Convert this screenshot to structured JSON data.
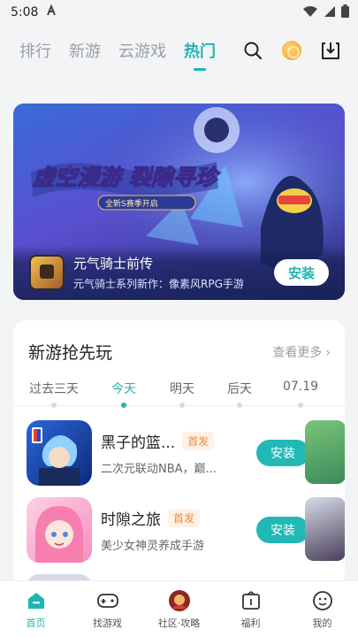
{
  "status_bar": {
    "time": "5:08"
  },
  "top_nav": {
    "tabs": [
      {
        "label": "排行",
        "active": false
      },
      {
        "label": "新游",
        "active": false
      },
      {
        "label": "云游戏",
        "active": false
      },
      {
        "label": "热门",
        "active": true
      }
    ],
    "icons": [
      "search-icon",
      "coin-icon",
      "download-icon"
    ]
  },
  "banner": {
    "app_title": "元气骑士前传",
    "app_subtitle": "元气骑士系列新作：像素风RPG手游",
    "install_label": "安装"
  },
  "new_games": {
    "title": "新游抢先玩",
    "see_more": "查看更多",
    "date_tabs": [
      {
        "label": "过去三天",
        "active": false
      },
      {
        "label": "今天",
        "active": true
      },
      {
        "label": "明天",
        "active": false
      },
      {
        "label": "后天",
        "active": false
      },
      {
        "label": "07.19",
        "active": false
      }
    ],
    "games": [
      {
        "name": "黑子的篮...",
        "badge": "首发",
        "desc": "二次元联动NBA，巅...",
        "install_label": "安装"
      },
      {
        "name": "时隙之旅",
        "badge": "首发",
        "desc": "美少女神灵养成手游",
        "install_label": "安装"
      }
    ]
  },
  "bottom_nav": {
    "items": [
      {
        "label": "首页",
        "icon": "home-icon",
        "active": true
      },
      {
        "label": "找游戏",
        "icon": "gamepad-icon",
        "active": false
      },
      {
        "label": "社区·攻略",
        "icon": "community-avatar-icon",
        "active": false
      },
      {
        "label": "福利",
        "icon": "gift-calendar-icon",
        "active": false
      },
      {
        "label": "我的",
        "icon": "profile-icon",
        "active": false
      }
    ]
  },
  "colors": {
    "accent": "#1eb5b0",
    "badge_text": "#f08a3b",
    "background": "#f3f4f6"
  }
}
